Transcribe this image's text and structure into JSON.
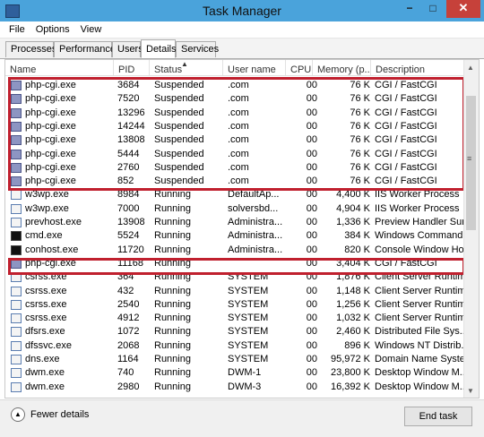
{
  "window": {
    "title": "Task Manager",
    "min_glyph": "−",
    "max_glyph": "□",
    "close_glyph": "✕"
  },
  "menu": [
    "File",
    "Options",
    "View"
  ],
  "tabs": [
    {
      "label": "Processes",
      "active": false
    },
    {
      "label": "Performance",
      "active": false
    },
    {
      "label": "Users",
      "active": false
    },
    {
      "label": "Details",
      "active": true
    },
    {
      "label": "Services",
      "active": false
    }
  ],
  "columns": [
    "Name",
    "PID",
    "Status",
    "User name",
    "CPU",
    "Memory (p...",
    "Description"
  ],
  "rows": [
    {
      "name": "php-cgi.exe",
      "pid": "3684",
      "status": "Suspended",
      "user": ".com",
      "cpu": "00",
      "mem": "76 K",
      "desc": "CGI / FastCGI",
      "icon": "php"
    },
    {
      "name": "php-cgi.exe",
      "pid": "7520",
      "status": "Suspended",
      "user": ".com",
      "cpu": "00",
      "mem": "76 K",
      "desc": "CGI / FastCGI",
      "icon": "php"
    },
    {
      "name": "php-cgi.exe",
      "pid": "13296",
      "status": "Suspended",
      "user": ".com",
      "cpu": "00",
      "mem": "76 K",
      "desc": "CGI / FastCGI",
      "icon": "php"
    },
    {
      "name": "php-cgi.exe",
      "pid": "14244",
      "status": "Suspended",
      "user": ".com",
      "cpu": "00",
      "mem": "76 K",
      "desc": "CGI / FastCGI",
      "icon": "php"
    },
    {
      "name": "php-cgi.exe",
      "pid": "13808",
      "status": "Suspended",
      "user": ".com",
      "cpu": "00",
      "mem": "76 K",
      "desc": "CGI / FastCGI",
      "icon": "php"
    },
    {
      "name": "php-cgi.exe",
      "pid": "5444",
      "status": "Suspended",
      "user": ".com",
      "cpu": "00",
      "mem": "76 K",
      "desc": "CGI / FastCGI",
      "icon": "php"
    },
    {
      "name": "php-cgi.exe",
      "pid": "2760",
      "status": "Suspended",
      "user": ".com",
      "cpu": "00",
      "mem": "76 K",
      "desc": "CGI / FastCGI",
      "icon": "php"
    },
    {
      "name": "php-cgi.exe",
      "pid": "852",
      "status": "Suspended",
      "user": ".com",
      "cpu": "00",
      "mem": "76 K",
      "desc": "CGI / FastCGI",
      "icon": "php"
    },
    {
      "name": "w3wp.exe",
      "pid": "8984",
      "status": "Running",
      "user": "DefaultAp...",
      "cpu": "00",
      "mem": "4,400 K",
      "desc": "IIS Worker Process",
      "icon": "win"
    },
    {
      "name": "w3wp.exe",
      "pid": "7000",
      "status": "Running",
      "user": "solversbd...",
      "cpu": "00",
      "mem": "4,904 K",
      "desc": "IIS Worker Process",
      "icon": "win"
    },
    {
      "name": "prevhost.exe",
      "pid": "13908",
      "status": "Running",
      "user": "Administra...",
      "cpu": "00",
      "mem": "1,336 K",
      "desc": "Preview Handler Sur...",
      "icon": "win"
    },
    {
      "name": "cmd.exe",
      "pid": "5524",
      "status": "Running",
      "user": "Administra...",
      "cpu": "00",
      "mem": "384 K",
      "desc": "Windows Command...",
      "icon": "cmd"
    },
    {
      "name": "conhost.exe",
      "pid": "11720",
      "status": "Running",
      "user": "Administra...",
      "cpu": "00",
      "mem": "820 K",
      "desc": "Console Window Host",
      "icon": "cmd"
    },
    {
      "name": "php-cgi.exe",
      "pid": "11168",
      "status": "Running",
      "user": "",
      "cpu": "00",
      "mem": "3,404 K",
      "desc": "CGI / FastCGI",
      "icon": "php"
    },
    {
      "name": "csrss.exe",
      "pid": "364",
      "status": "Running",
      "user": "SYSTEM",
      "cpu": "00",
      "mem": "1,876 K",
      "desc": "Client Server Runtim...",
      "icon": "win"
    },
    {
      "name": "csrss.exe",
      "pid": "432",
      "status": "Running",
      "user": "SYSTEM",
      "cpu": "00",
      "mem": "1,148 K",
      "desc": "Client Server Runtim...",
      "icon": "win"
    },
    {
      "name": "csrss.exe",
      "pid": "2540",
      "status": "Running",
      "user": "SYSTEM",
      "cpu": "00",
      "mem": "1,256 K",
      "desc": "Client Server Runtim...",
      "icon": "win"
    },
    {
      "name": "csrss.exe",
      "pid": "4912",
      "status": "Running",
      "user": "SYSTEM",
      "cpu": "00",
      "mem": "1,032 K",
      "desc": "Client Server Runtim...",
      "icon": "win"
    },
    {
      "name": "dfsrs.exe",
      "pid": "1072",
      "status": "Running",
      "user": "SYSTEM",
      "cpu": "00",
      "mem": "2,460 K",
      "desc": "Distributed File Sys...",
      "icon": "win"
    },
    {
      "name": "dfssvc.exe",
      "pid": "2068",
      "status": "Running",
      "user": "SYSTEM",
      "cpu": "00",
      "mem": "896 K",
      "desc": "Windows NT Distrib...",
      "icon": "win"
    },
    {
      "name": "dns.exe",
      "pid": "1164",
      "status": "Running",
      "user": "SYSTEM",
      "cpu": "00",
      "mem": "95,972 K",
      "desc": "Domain Name Syste...",
      "icon": "win"
    },
    {
      "name": "dwm.exe",
      "pid": "740",
      "status": "Running",
      "user": "DWM-1",
      "cpu": "00",
      "mem": "23,800 K",
      "desc": "Desktop Window M...",
      "icon": "win"
    },
    {
      "name": "dwm.exe",
      "pid": "2980",
      "status": "Running",
      "user": "DWM-3",
      "cpu": "00",
      "mem": "16,392 K",
      "desc": "Desktop Window M...",
      "icon": "win"
    }
  ],
  "footer": {
    "fewer_details": "Fewer details",
    "end_task": "End task"
  },
  "colors": {
    "titlebar": "#4aa3db",
    "highlight": "#c0202e",
    "close": "#c6413a"
  }
}
